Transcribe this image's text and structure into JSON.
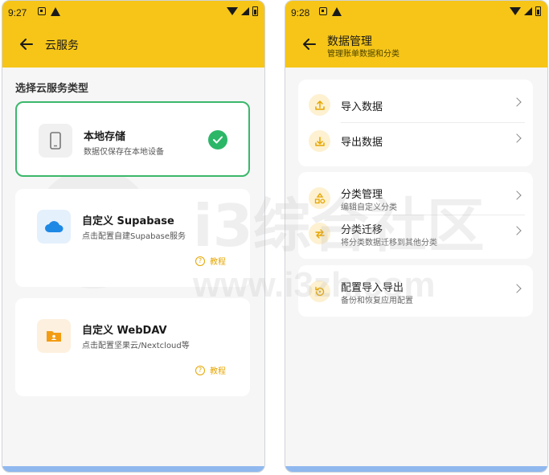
{
  "left": {
    "status": {
      "time": "9:27"
    },
    "header": {
      "title": "云服务"
    },
    "section_label": "选择云服务类型",
    "options": [
      {
        "title": "本地存储",
        "desc": "数据仅保存在本地设备",
        "selected": true,
        "icon": "phone-icon"
      },
      {
        "title": "自定义 Supabase",
        "desc": "点击配置自建Supabase服务",
        "tutorial": "教程",
        "icon": "cloud-icon"
      },
      {
        "title": "自定义 WebDAV",
        "desc": "点击配置坚果云/Nextcloud等",
        "tutorial": "教程",
        "icon": "folder-user-icon"
      }
    ]
  },
  "right": {
    "status": {
      "time": "9:28"
    },
    "header": {
      "title": "数据管理",
      "subtitle": "管理账单数据和分类"
    },
    "groups": [
      {
        "items": [
          {
            "label": "导入数据",
            "icon": "upload-icon"
          },
          {
            "label": "导出数据",
            "icon": "download-icon"
          }
        ]
      },
      {
        "items": [
          {
            "label": "分类管理",
            "sub": "编辑自定义分类",
            "icon": "shapes-icon"
          },
          {
            "label": "分类迁移",
            "sub": "将分类数据迁移到其他分类",
            "icon": "swap-icon"
          }
        ]
      },
      {
        "items": [
          {
            "label": "配置导入导出",
            "sub": "备份和恢复应用配置",
            "icon": "restore-icon"
          }
        ]
      }
    ]
  },
  "watermark": {
    "text": "i3综合社区",
    "url": "www.i3zh.com"
  },
  "colors": {
    "header": "#f6c517",
    "accent_green": "#2cb768",
    "tutorial": "#e6a500",
    "bottom_bar": "#8fb8ee"
  }
}
